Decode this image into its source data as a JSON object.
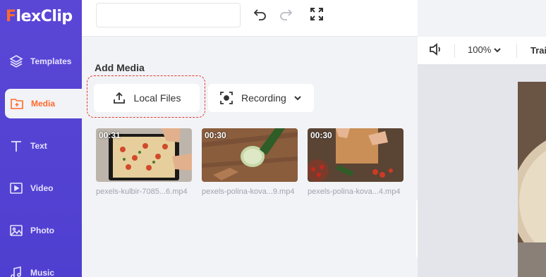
{
  "app": {
    "logo_text": "FlexClip",
    "logo_accent_color": "#ff6a2b"
  },
  "sidebar": {
    "items": [
      {
        "label": "Templates",
        "icon": "layers-icon",
        "active": false
      },
      {
        "label": "Media",
        "icon": "folder-plus-icon",
        "active": true
      },
      {
        "label": "Text",
        "icon": "text-icon",
        "active": false
      },
      {
        "label": "Video",
        "icon": "video-icon",
        "active": false
      },
      {
        "label": "Photo",
        "icon": "photo-icon",
        "active": false
      },
      {
        "label": "Music",
        "icon": "music-icon",
        "active": false
      }
    ]
  },
  "toolbar": {
    "project_name": ""
  },
  "media_panel": {
    "title": "Add Media",
    "local_files_label": "Local Files",
    "recording_label": "Recording",
    "items": [
      {
        "duration": "00:31",
        "filename": "pexels-kulbir-7085...6.mp4"
      },
      {
        "duration": "00:30",
        "filename": "pexels-polina-kova...9.mp4"
      },
      {
        "duration": "00:30",
        "filename": "pexels-polina-kova...4.mp4"
      }
    ]
  },
  "editor": {
    "zoom": "100%",
    "transition_label": "Trai"
  },
  "colors": {
    "sidebar": "#5a47d6",
    "accent": "#ff6a2b",
    "highlight_dash": "#e0392b"
  }
}
